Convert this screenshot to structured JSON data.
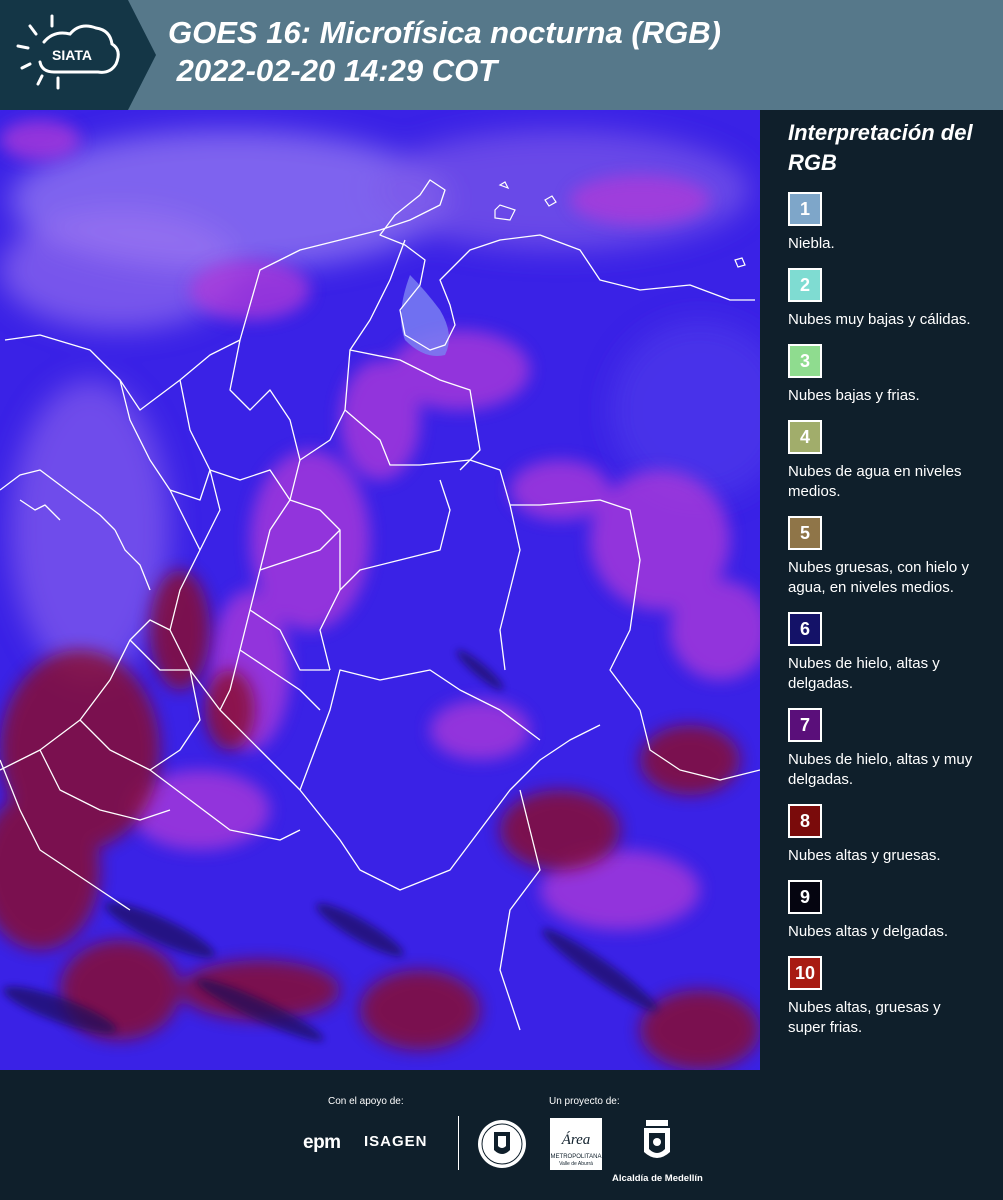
{
  "header": {
    "logo_text": "SIATA",
    "title": "GOES 16: Microfísica nocturna (RGB)\n 2022-02-20 14:29 COT"
  },
  "legend": {
    "title": "Interpretación del RGB",
    "items": [
      {
        "number": "1",
        "color": "#7ea6c9",
        "label": "Niebla."
      },
      {
        "number": "2",
        "color": "#7fdcd2",
        "label": "Nubes muy bajas y cálidas."
      },
      {
        "number": "3",
        "color": "#8fdc8f",
        "label": "Nubes bajas y frias."
      },
      {
        "number": "4",
        "color": "#a1ad6b",
        "label": "Nubes de agua en niveles medios."
      },
      {
        "number": "5",
        "color": "#8f7548",
        "label": "Nubes gruesas, con hielo y agua, en niveles medios."
      },
      {
        "number": "6",
        "color": "#141268",
        "label": "Nubes de hielo, altas y delgadas."
      },
      {
        "number": "7",
        "color": "#5a0f7a",
        "label": "Nubes de hielo, altas y muy delgadas."
      },
      {
        "number": "8",
        "color": "#7a0b0b",
        "label": "Nubes altas y gruesas."
      },
      {
        "number": "9",
        "color": "#050510",
        "label": "Nubes altas y delgadas."
      },
      {
        "number": "10",
        "color": "#a81b12",
        "label": "Nubes altas, gruesas y super frias."
      }
    ]
  },
  "footer": {
    "support_label": "Con el apoyo de:",
    "support_logos": [
      "epm",
      "ISAGEN"
    ],
    "project_label": "Un proyecto de:",
    "project_logos": [
      "Área Metropolitana Valle de Aburrá",
      "Alcaldía de Medellín"
    ],
    "area_logo_text": "Área",
    "area_logo_subtitle": "METROPOLITANA",
    "area_logo_subtitle2": "Valle de Aburrá",
    "alcaldia_label": "Alcaldía de Medellín"
  },
  "map": {
    "colors": {
      "base_blue": "#3b1fe0",
      "magenta_cloud": "#8a2bd0",
      "dark_red_cloud": "#8b1030",
      "border_white": "#ffffff"
    }
  }
}
